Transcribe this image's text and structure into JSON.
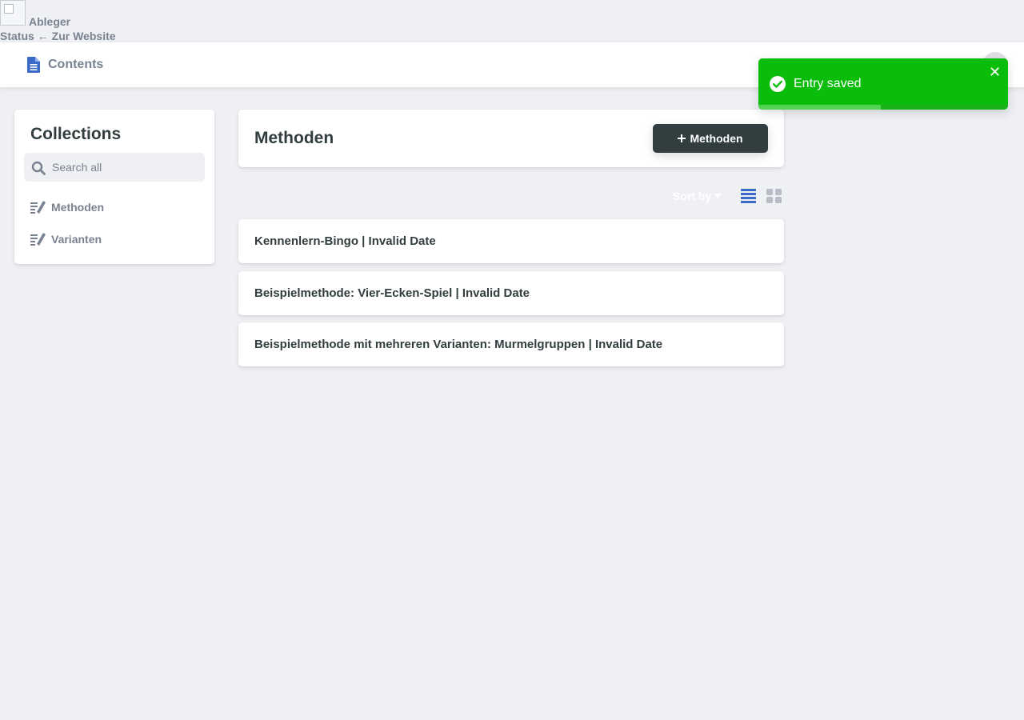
{
  "app": {
    "name": "Ableger",
    "status_label": "Status",
    "back_link": "← Zur Website"
  },
  "header": {
    "nav_contents": "Contents"
  },
  "sidebar": {
    "title": "Collections",
    "search_placeholder": "Search all",
    "items": [
      {
        "label": "Methoden",
        "icon": "collection-edit-icon"
      },
      {
        "label": "Varianten",
        "icon": "collection-edit-icon"
      }
    ]
  },
  "main": {
    "title": "Methoden",
    "new_button_label": "Methoden",
    "sort_by_label": "Sort by",
    "view_modes": [
      "list-view-icon",
      "grid-view-icon"
    ],
    "active_view": "list",
    "entries": [
      "Kennenlern-Bingo | Invalid Date",
      "Beispielmethode: Vier-Ecken-Spiel | Invalid Date",
      "Beispielmethode mit mehreren Varianten: Murmelgruppen | Invalid Date"
    ]
  },
  "toast": {
    "message": "Entry saved",
    "progress": 0.49,
    "color": "#0bbd0b"
  },
  "colors": {
    "accent": "#3a69c7",
    "background": "#eff0f4",
    "text": "#313d3e",
    "muted": "#798291",
    "button_dark": "#313d3e"
  }
}
